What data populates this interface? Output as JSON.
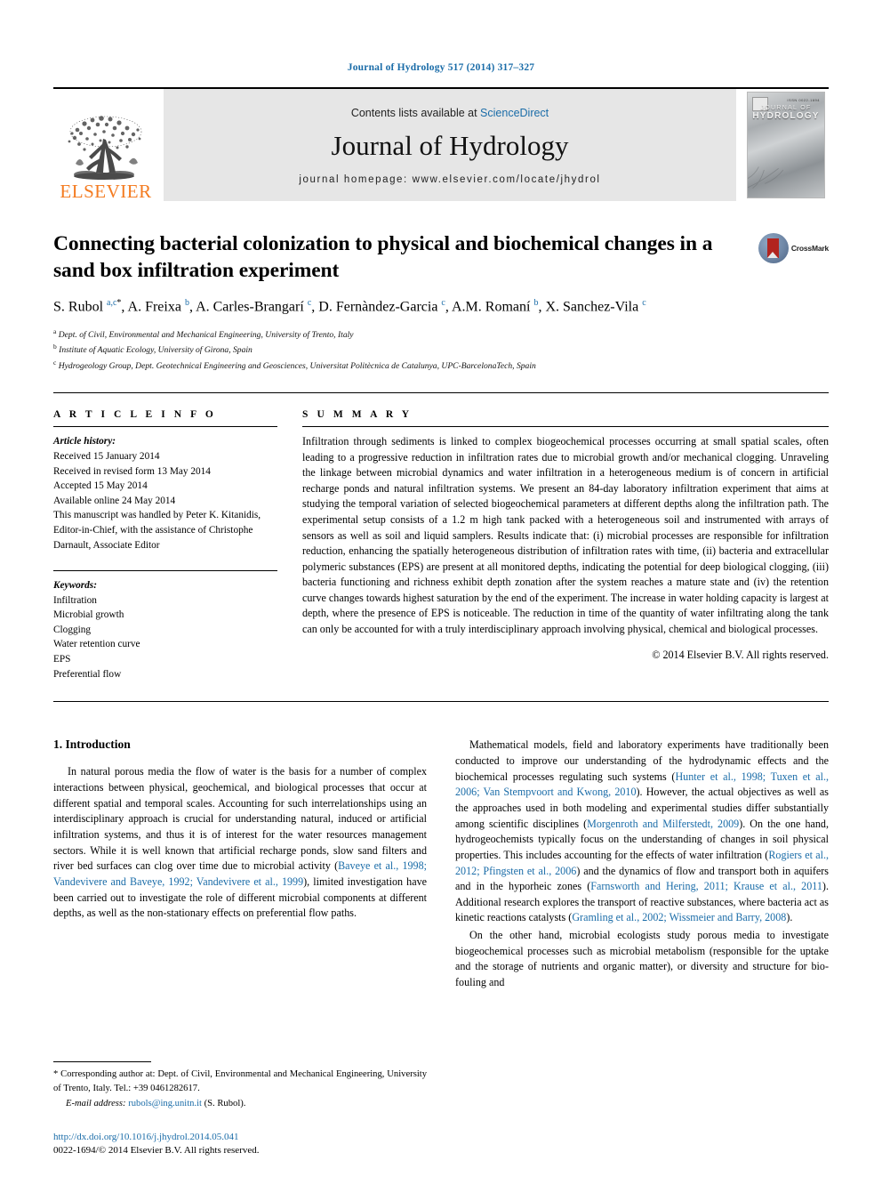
{
  "running_head": "Journal of Hydrology 517 (2014) 317–327",
  "masthead": {
    "publisher_name": "ELSEVIER",
    "contents_prefix": "Contents lists available at ",
    "contents_link": "ScienceDirect",
    "journal_title": "Journal of Hydrology",
    "homepage_line": "journal homepage: www.elsevier.com/locate/jhydrol",
    "cover_line1": "JOURNAL OF",
    "cover_line2": "HYDROLOGY",
    "cover_code": "ISSN 0022-1694"
  },
  "article": {
    "title": "Connecting bacterial colonization to physical and biochemical changes in a sand box infiltration experiment",
    "crossmark_label": "CrossMark",
    "authors_html": "S. Rubol <sup>a,c</sup><sup class=\"star\">*</sup>, A. Freixa <sup>b</sup>, A. Carles-Brangarí <sup>c</sup>, D. Fernàndez-Garcia <sup>c</sup>, A.M. Romaní <sup>b</sup>, X. Sanchez-Vila <sup>c</sup>",
    "affiliations": [
      {
        "mark": "a",
        "text": "Dept. of Civil, Environmental and Mechanical Engineering, University of Trento, Italy"
      },
      {
        "mark": "b",
        "text": "Institute of Aquatic Ecology, University of Girona, Spain"
      },
      {
        "mark": "c",
        "text": "Hydrogeology Group, Dept. Geotechnical Engineering and Geosciences, Universitat Politècnica de Catalunya, UPC-BarcelonaTech, Spain"
      }
    ]
  },
  "info": {
    "heading": "A R T I C L E  I N F O",
    "history_label": "Article history:",
    "history": [
      "Received 15 January 2014",
      "Received in revised form 13 May 2014",
      "Accepted 15 May 2014",
      "Available online 24 May 2014",
      "This manuscript was handled by Peter K. Kitanidis, Editor-in-Chief, with the assistance of Christophe Darnault, Associate Editor"
    ],
    "keywords_label": "Keywords:",
    "keywords": [
      "Infiltration",
      "Microbial growth",
      "Clogging",
      "Water retention curve",
      "EPS",
      "Preferential flow"
    ]
  },
  "summary": {
    "heading": "S U M M A R Y",
    "text": "Infiltration through sediments is linked to complex biogeochemical processes occurring at small spatial scales, often leading to a progressive reduction in infiltration rates due to microbial growth and/or mechanical clogging. Unraveling the linkage between microbial dynamics and water infiltration in a heterogeneous medium is of concern in artificial recharge ponds and natural infiltration systems. We present an 84-day laboratory infiltration experiment that aims at studying the temporal variation of selected biogeochemical parameters at different depths along the infiltration path. The experimental setup consists of a 1.2 m high tank packed with a heterogeneous soil and instrumented with arrays of sensors as well as soil and liquid samplers. Results indicate that: (i) microbial processes are responsible for infiltration reduction, enhancing the spatially heterogeneous distribution of infiltration rates with time, (ii) bacteria and extracellular polymeric substances (EPS) are present at all monitored depths, indicating the potential for deep biological clogging, (iii) bacteria functioning and richness exhibit depth zonation after the system reaches a mature state and (iv) the retention curve changes towards highest saturation by the end of the experiment. The increase in water holding capacity is largest at depth, where the presence of EPS is noticeable. The reduction in time of the quantity of water infiltrating along the tank can only be accounted for with a truly interdisciplinary approach involving physical, chemical and biological processes.",
    "copyright": "© 2014 Elsevier B.V. All rights reserved."
  },
  "body": {
    "section_title": "1. Introduction",
    "left_paragraphs": [
      {
        "segments": [
          {
            "t": "In natural porous media the flow of water is the basis for a number of complex interactions between physical, geochemical, and biological processes that occur at different spatial and temporal scales. Accounting for such interrelationships using an interdisciplinary approach is crucial for understanding natural, induced or artificial infiltration systems, and thus it is of interest for the water resources management sectors. While it is well known that artificial recharge ponds, slow sand filters and river bed surfaces can clog over time due to microbial activity (",
            "cite": false
          },
          {
            "t": "Baveye et al., 1998; Vandevivere and Baveye, 1992; Vandevivere et al., 1999",
            "cite": true
          },
          {
            "t": "), limited investigation have been carried out to investigate the role of different microbial components at different depths, as well as the non-stationary effects on preferential flow paths.",
            "cite": false
          }
        ]
      }
    ],
    "right_paragraphs": [
      {
        "segments": [
          {
            "t": "Mathematical models, field and laboratory experiments have traditionally been conducted to improve our understanding of the hydrodynamic effects and the biochemical processes regulating such systems (",
            "cite": false
          },
          {
            "t": "Hunter et al., 1998; Tuxen et al., 2006; Van Stempvoort and Kwong, 2010",
            "cite": true
          },
          {
            "t": "). However, the actual objectives as well as the approaches used in both modeling and experimental studies differ substantially among scientific disciplines (",
            "cite": false
          },
          {
            "t": "Morgenroth and Milferstedt, 2009",
            "cite": true
          },
          {
            "t": "). On the one hand, hydrogeochemists typically focus on the understanding of changes in soil physical properties. This includes accounting for the effects of water infiltration (",
            "cite": false
          },
          {
            "t": "Rogiers et al., 2012; Pfingsten et al., 2006",
            "cite": true
          },
          {
            "t": ") and the dynamics of flow and transport both in aquifers and in the hyporheic zones (",
            "cite": false
          },
          {
            "t": "Farnsworth and Hering, 2011; Krause et al., 2011",
            "cite": true
          },
          {
            "t": "). Additional research explores the transport of reactive substances, where bacteria act as kinetic reactions catalysts (",
            "cite": false
          },
          {
            "t": "Gramling et al., 2002; Wissmeier and Barry, 2008",
            "cite": true
          },
          {
            "t": ").",
            "cite": false
          }
        ]
      },
      {
        "segments": [
          {
            "t": "On the other hand, microbial ecologists study porous media to investigate biogeochemical processes such as microbial metabolism (responsible for the uptake and the storage of nutrients and organic matter), or diversity and structure for bio-fouling and",
            "cite": false
          }
        ]
      }
    ]
  },
  "footnote": {
    "corresponding": "* Corresponding author at: Dept. of Civil, Environmental and Mechanical Engineering, University of Trento, Italy. Tel.: +39 0461282617.",
    "email_label": "E-mail address:",
    "email": "rubols@ing.unitn.it",
    "email_suffix": "(S. Rubol)."
  },
  "imprint": {
    "doi": "http://dx.doi.org/10.1016/j.jhydrol.2014.05.041",
    "issn_line": "0022-1694/© 2014 Elsevier B.V. All rights reserved."
  },
  "colors": {
    "link": "#1a6ca8",
    "elsevier_orange": "#F47B20",
    "band_gray": "#e6e6e6"
  }
}
